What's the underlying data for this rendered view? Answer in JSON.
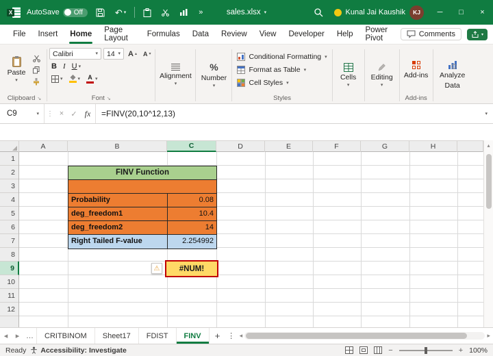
{
  "titlebar": {
    "autosave_label": "AutoSave",
    "autosave_state": "Off",
    "filename": "sales.xlsx",
    "user_name": "Kunal Jai Kaushik",
    "user_initials": "KJ"
  },
  "menubar": {
    "tabs": [
      "File",
      "Insert",
      "Home",
      "Page Layout",
      "Formulas",
      "Data",
      "Review",
      "View",
      "Developer",
      "Help",
      "Power Pivot"
    ],
    "active_tab": "Home",
    "comments_label": "Comments"
  },
  "ribbon": {
    "paste_label": "Paste",
    "clipboard_group_label": "Clipboard",
    "font_name": "Calibri",
    "font_size": "14",
    "bold_label": "B",
    "italic_label": "I",
    "underline_label": "U",
    "font_group_label": "Font",
    "alignment_label": "Alignment",
    "number_label": "Number",
    "conditional_formatting_label": "Conditional Formatting",
    "format_as_table_label": "Format as Table",
    "cell_styles_label": "Cell Styles",
    "styles_group_label": "Styles",
    "cells_label": "Cells",
    "editing_label": "Editing",
    "addins_label": "Add-ins",
    "addins_group_label": "Add-ins",
    "analyze_line1": "Analyze",
    "analyze_line2": "Data"
  },
  "formula_bar": {
    "name_box": "C9",
    "fx_label": "fx",
    "formula": "=FINV(20,10^12,13)"
  },
  "grid": {
    "col_headers": [
      "A",
      "B",
      "C",
      "D",
      "E",
      "F",
      "G",
      "H"
    ],
    "row_numbers": [
      "1",
      "2",
      "3",
      "4",
      "5",
      "6",
      "7",
      "8",
      "9",
      "10",
      "11",
      "12"
    ],
    "selected_cell": "C9",
    "table": {
      "title": "FINV Function",
      "rows": [
        {
          "label": "Probability",
          "value": "0.08"
        },
        {
          "label": "deg_freedom1",
          "value": "10.4"
        },
        {
          "label": "deg_freedom2",
          "value": "14"
        },
        {
          "label": "Right Tailed F-value",
          "value": "2.254992"
        }
      ]
    },
    "error_value": "#NUM!"
  },
  "sheet_bar": {
    "tabs": [
      "CRITBINOM",
      "Sheet17",
      "FDIST",
      "FINV"
    ],
    "active_tab": "FINV"
  },
  "status_bar": {
    "mode": "Ready",
    "accessibility": "Accessibility: Investigate",
    "zoom": "100%"
  },
  "icons": {
    "caret_down": "▾",
    "undo": "↶",
    "overflow_chevron": "»",
    "minimize": "─",
    "maximize": "□",
    "close": "×",
    "warning": "⚠",
    "ellipsis_tabs": "…",
    "add_sheet": "+",
    "nav_left": "◂",
    "nav_right": "▸",
    "vertical_dots": "⋮",
    "cancel": "×",
    "enter": "✓",
    "percent": "%",
    "scroll_up": "▴"
  },
  "colors": {
    "excel_green": "#107C41",
    "table_header": "#A9D08E",
    "input_orange": "#ED7D31",
    "result_blue": "#BDD7EE",
    "error_fill": "#FFD966",
    "error_border": "#C00000"
  }
}
